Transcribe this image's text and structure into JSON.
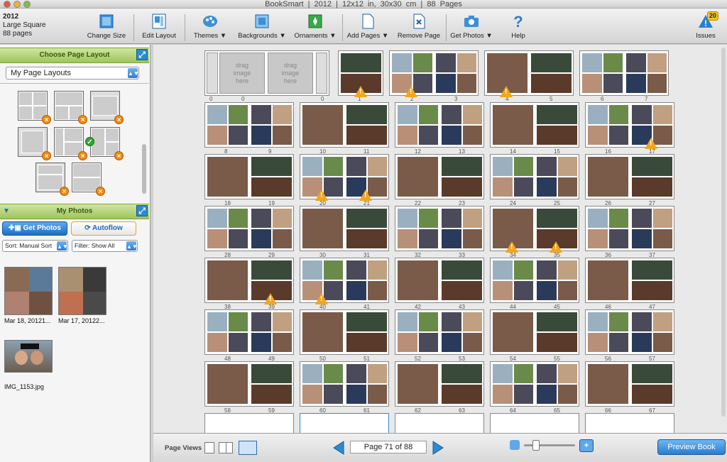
{
  "window": {
    "title": "BookSmart  |  2012  |  12x12 in, 30x30 cm  |  88 Pages"
  },
  "book": {
    "name": "2012",
    "size": "Large Square",
    "pages": "88 pages"
  },
  "toolbar": {
    "change_size": "Change Size",
    "edit_layout": "Edit Layout",
    "themes": "Themes ▼",
    "backgrounds": "Backgrounds ▼",
    "ornaments": "Ornaments ▼",
    "add_pages": "Add Pages ▼",
    "remove_page": "Remove Page",
    "get_photos": "Get Photos ▼",
    "help": "Help",
    "issues": "Issues",
    "issues_count": "20"
  },
  "layout_panel": {
    "title": "Choose Page Layout",
    "selected": "My Page Layouts"
  },
  "photos_panel": {
    "title": "My Photos",
    "get_photos": "Get Photos",
    "autoflow": "Autoflow",
    "sort": "Sort:  Manual Sort",
    "filter": "Filter:  Show All",
    "photos": [
      {
        "caption": "Mar 18, 20121..."
      },
      {
        "caption": "Mar 17, 20122..."
      },
      {
        "caption": "IMG_1153.jpg"
      }
    ]
  },
  "placeholders": {
    "line1": "drag",
    "line2": "image",
    "line3": "here"
  },
  "pages": [
    "0",
    "0",
    "0",
    "1",
    "2",
    "3",
    "4",
    "5",
    "6",
    "7",
    "8",
    "9",
    "10",
    "11",
    "12",
    "13",
    "14",
    "15",
    "16",
    "17",
    "18",
    "19",
    "20",
    "21",
    "22",
    "23",
    "24",
    "25",
    "26",
    "27",
    "28",
    "29",
    "30",
    "31",
    "32",
    "33",
    "34",
    "35",
    "36",
    "37",
    "38",
    "39",
    "40",
    "41",
    "42",
    "43",
    "44",
    "45",
    "46",
    "47",
    "48",
    "49",
    "50",
    "51",
    "52",
    "53",
    "54",
    "55",
    "56",
    "57",
    "58",
    "59",
    "60",
    "61",
    "62",
    "63",
    "64",
    "65",
    "66",
    "67"
  ],
  "bottom": {
    "page_views": "Page Views",
    "page_indicator": "Page 71 of 88",
    "preview": "Preview Book"
  },
  "colors": {
    "accent": "#2a8ad4",
    "warning": "#f2a61c",
    "panel_green": "#9fc45c"
  }
}
